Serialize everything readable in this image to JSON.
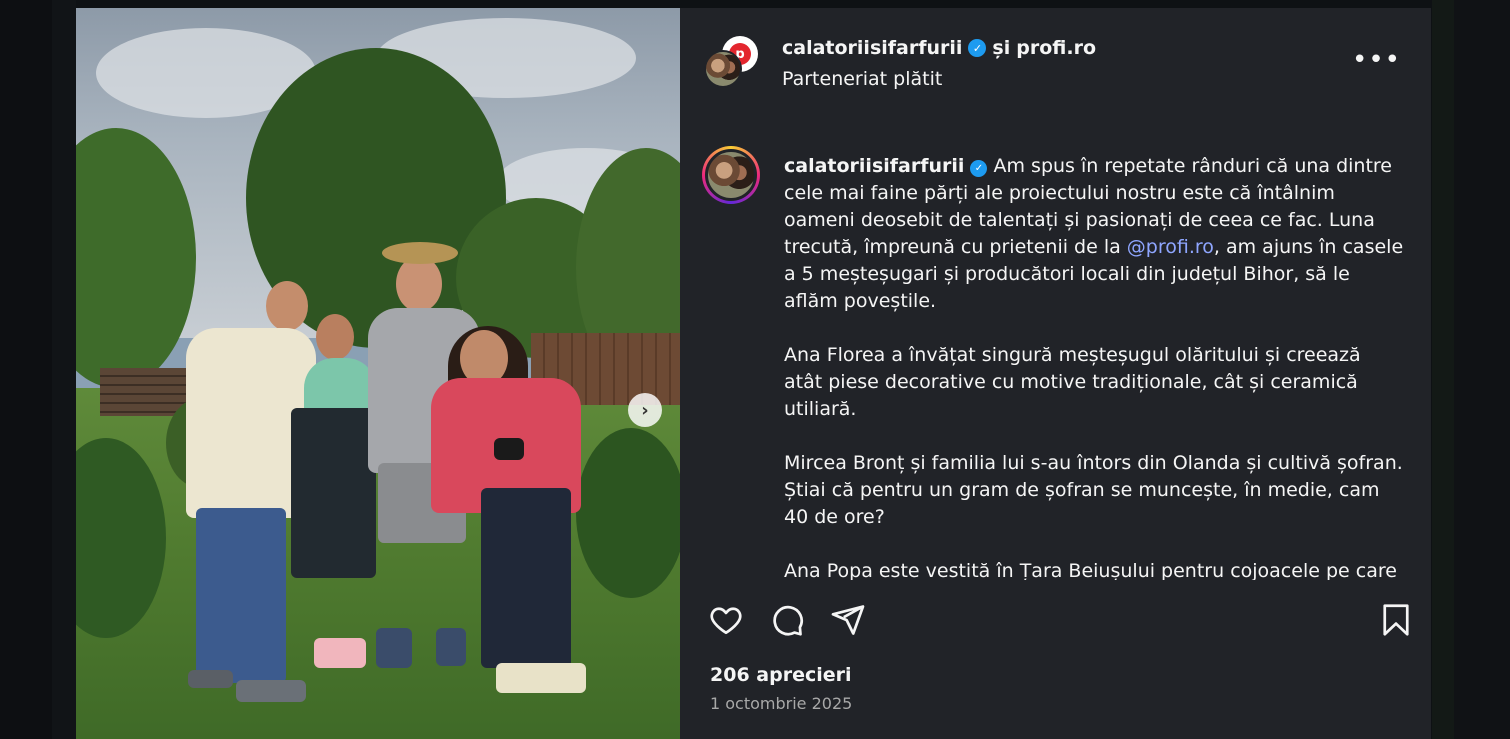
{
  "post": {
    "author_username": "calatoriisifarfurii",
    "partner_conjunction": "și",
    "partner_username": "profi.ro",
    "subtitle": "Parteneriat plătit",
    "more_label": "•••",
    "next_label": "›",
    "brand_initial": "p",
    "verified_glyph": "✓"
  },
  "caption": {
    "username": "calatoriisifarfurii",
    "p1_before": " Am spus în repetate rânduri că una dintre cele mai faine părți ale proiectului nostru este că întâlnim oameni deosebit de talentați și pasionați de ceea ce fac. Luna trecută, împreună cu prietenii de la ",
    "mention": "@profi.ro",
    "p1_after": ", am ajuns în casele a 5 meșteșugari și producători locali din județul Bihor, să le aflăm poveștile.",
    "p2": "Ana Florea a învățat singură meșteșugul olăritului și creează atât piese decorative cu motive tradiționale, cât și ceramică utiliară.",
    "p3": "Mircea Bronț și familia lui s-au întors din Olanda și cultivă șofran. Știai că pentru un gram de șofran se muncește, în medie, cam 40 de ore?",
    "p4": "Ana Popa este vestită în Țara Beiușului pentru cojoacele pe care le face. Care sunt atât de impresionante încât au fost “inspirația” unei"
  },
  "stats": {
    "likes": "206 aprecieri",
    "date": "1 octombrie 2025"
  },
  "colors": {
    "panel_bg": "#212328",
    "mention": "#8fa6ff",
    "verified": "#1d9bf0"
  }
}
